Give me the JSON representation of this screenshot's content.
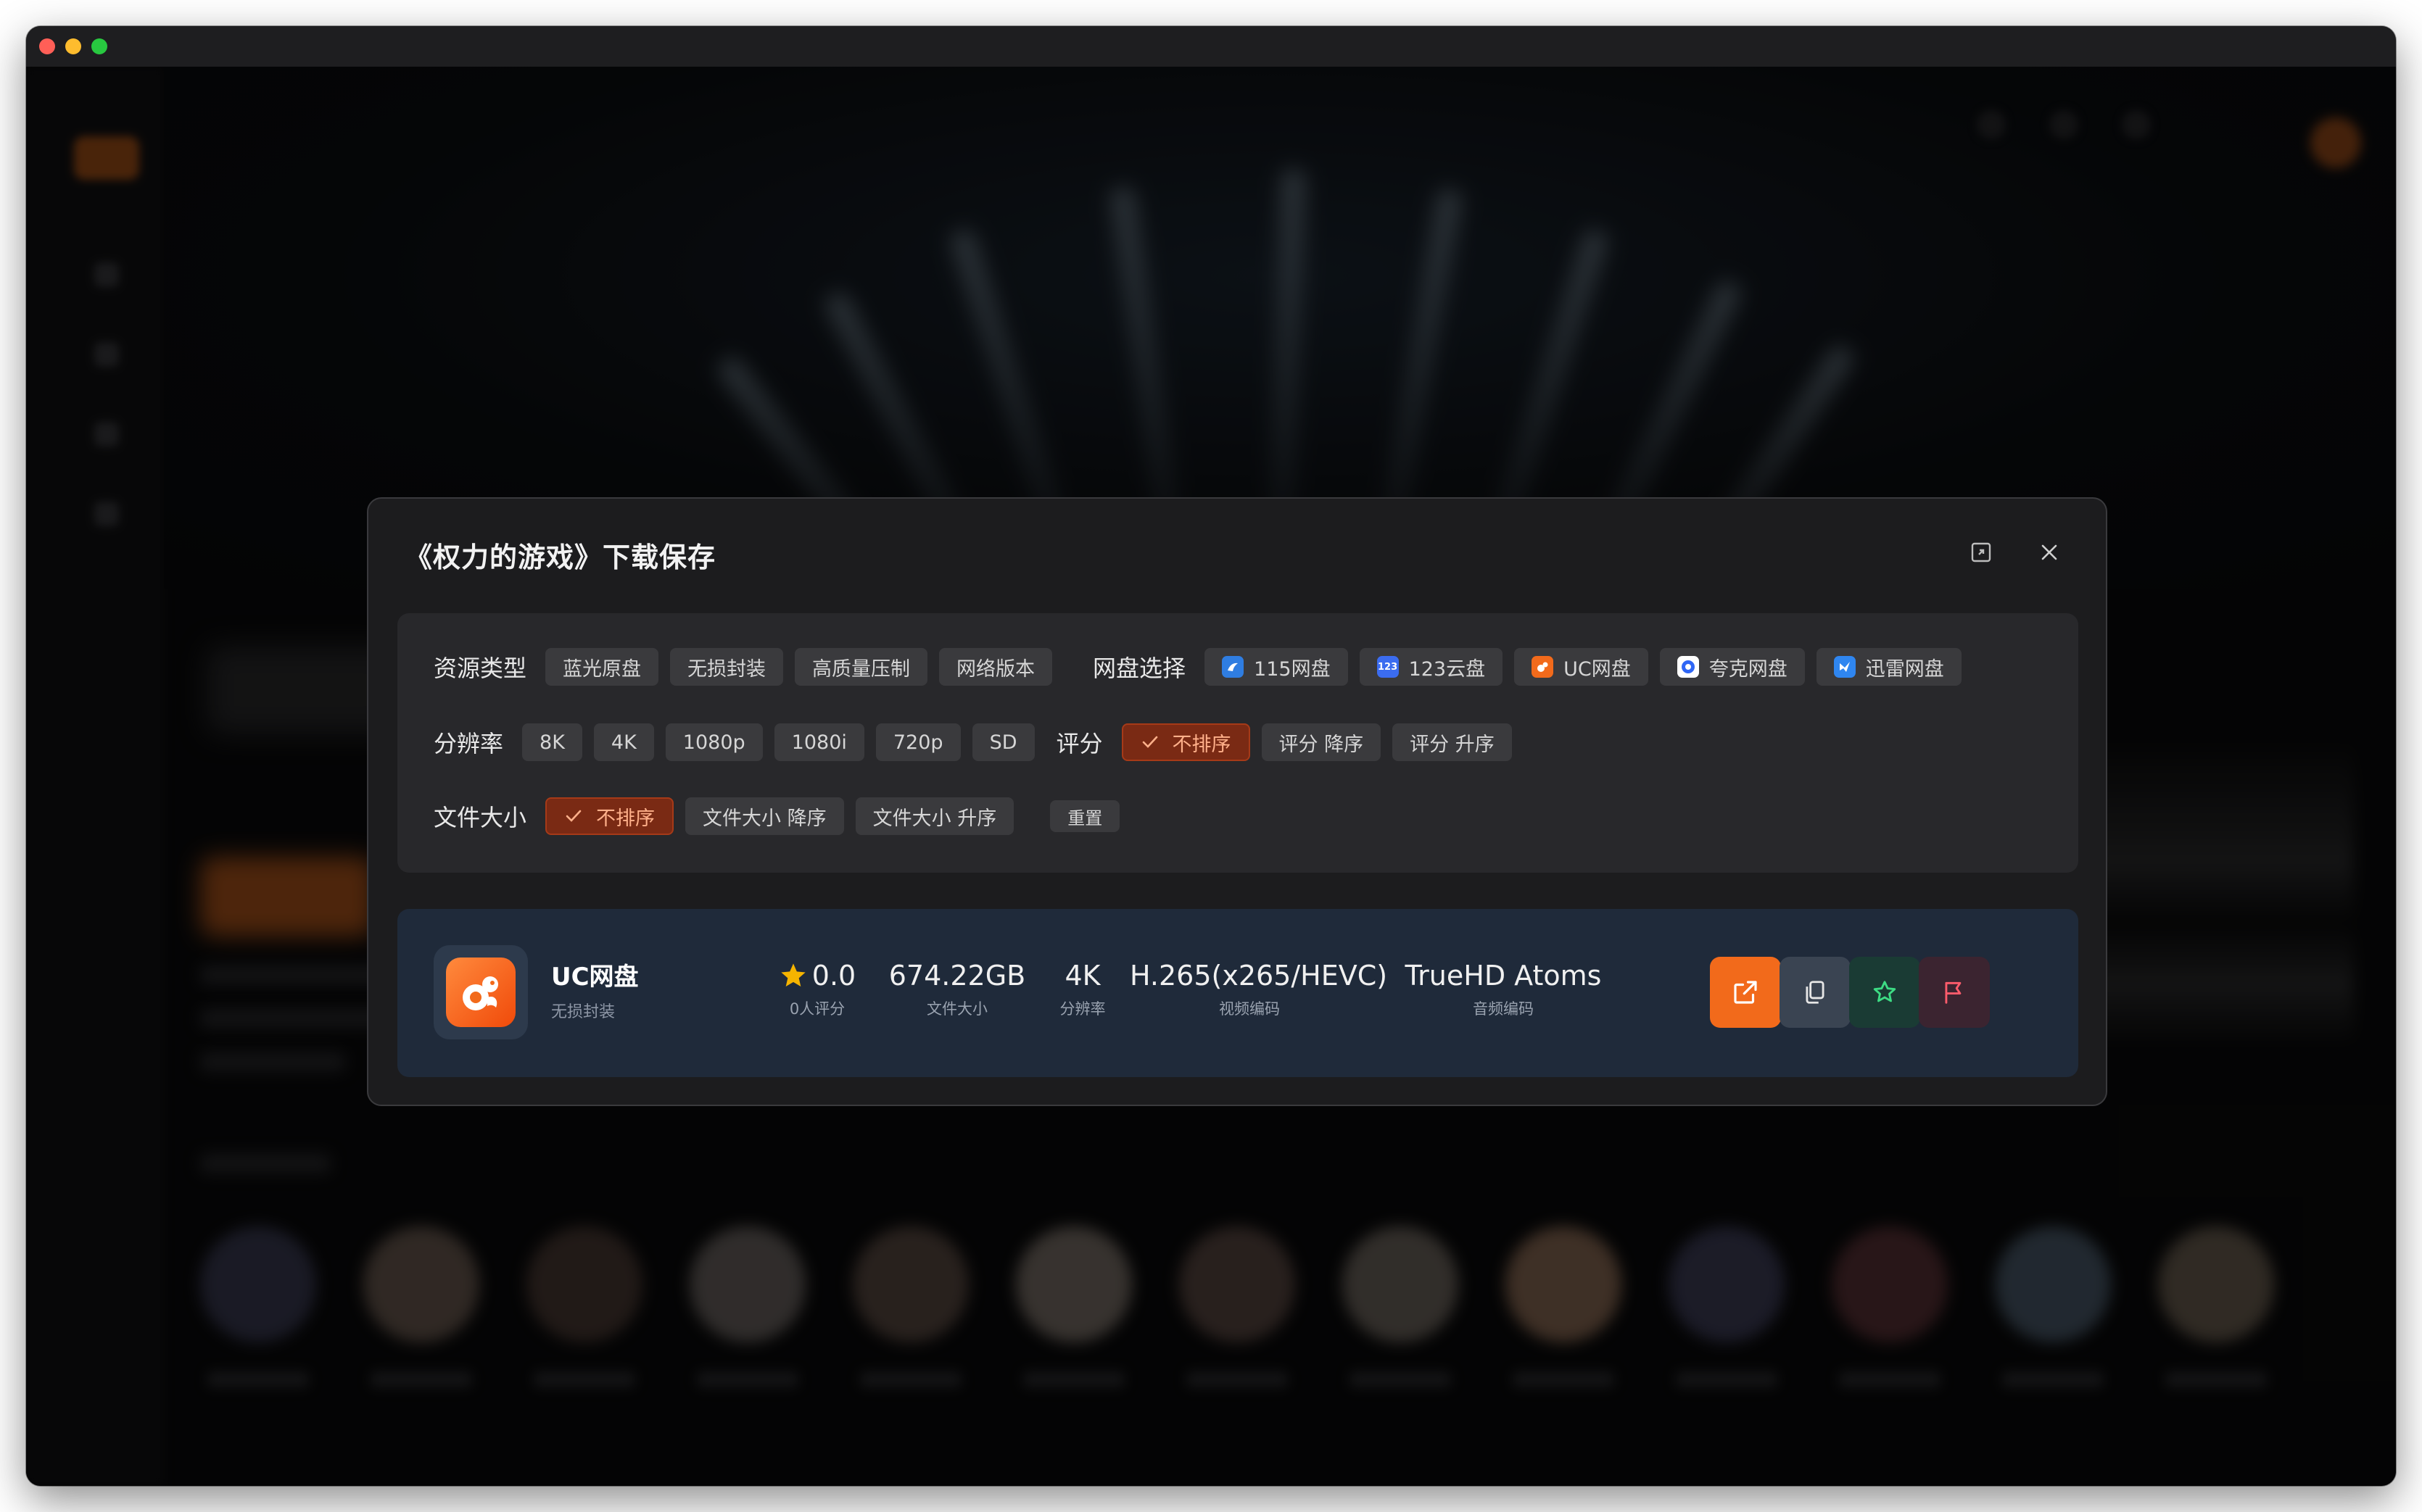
{
  "dialog": {
    "title": "《权力的游戏》下载保存"
  },
  "filters": {
    "resource_type": {
      "label": "资源类型",
      "options": [
        "蓝光原盘",
        "无损封装",
        "高质量压制",
        "网络版本"
      ]
    },
    "netdisk": {
      "label": "网盘选择",
      "options": [
        {
          "name": "115网盘",
          "icon": "115-icon",
          "color": "#2f7de1"
        },
        {
          "name": "123云盘",
          "icon": "123-icon",
          "color": "#3b6cf0"
        },
        {
          "name": "UC网盘",
          "icon": "uc-icon",
          "color": "#f26a1b"
        },
        {
          "name": "夸克网盘",
          "icon": "quark-icon",
          "color": "#2f66f5"
        },
        {
          "name": "迅雷网盘",
          "icon": "xunlei-icon",
          "color": "#2f86f0"
        }
      ]
    },
    "resolution": {
      "label": "分辨率",
      "options": [
        "8K",
        "4K",
        "1080p",
        "1080i",
        "720p",
        "SD"
      ]
    },
    "rating": {
      "label": "评分",
      "options": [
        "不排序",
        "评分 降序",
        "评分 升序"
      ],
      "selected": "不排序"
    },
    "file_size": {
      "label": "文件大小",
      "options": [
        "不排序",
        "文件大小 降序",
        "文件大小 升序"
      ],
      "selected": "不排序"
    },
    "reset_label": "重置"
  },
  "result": {
    "name": "UC网盘",
    "subtitle": "无损封装",
    "rating": {
      "value": "0.0",
      "label": "0人评分"
    },
    "size": {
      "value": "674.22GB",
      "label": "文件大小"
    },
    "resolution": {
      "value": "4K",
      "label": "分辨率"
    },
    "video_codec": {
      "value": "H.265(x265/HEVC)",
      "label": "视频编码"
    },
    "audio_codec": {
      "value": "TrueHD Atoms",
      "label": "音频编码"
    }
  },
  "colors": {
    "accent": "#f26a1b",
    "active_chip_bg": "#7a2a14",
    "result_bg": "#1f2a3a",
    "star": "#f5b400"
  }
}
